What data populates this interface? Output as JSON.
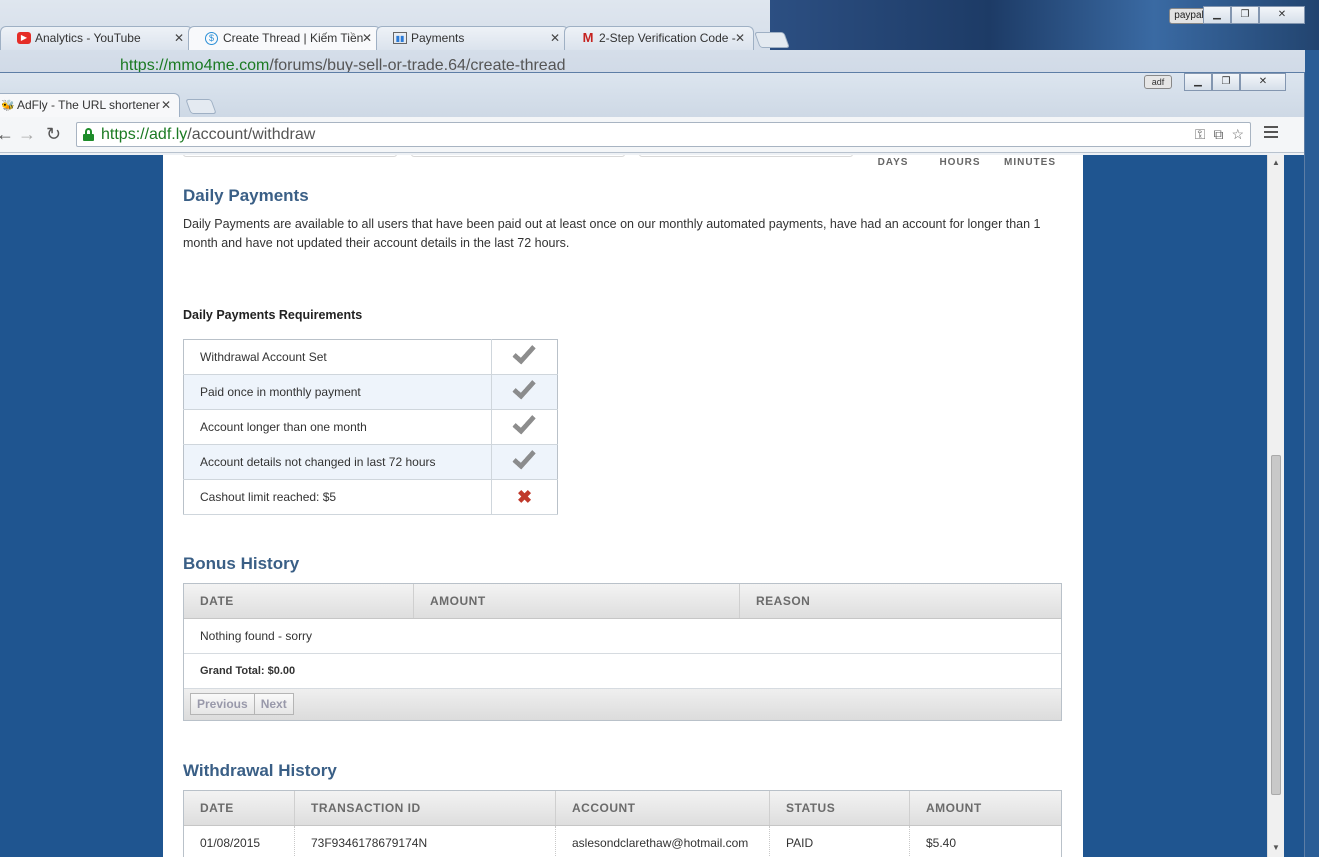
{
  "background_window": {
    "tabs": [
      {
        "label": "Analytics - YouTube",
        "icon": "youtube-icon"
      },
      {
        "label": "Create Thread | Kiếm Tiền",
        "icon": "site-icon"
      },
      {
        "label": "Payments",
        "icon": "analytics-icon"
      },
      {
        "label": "2-Step Verification Code -",
        "icon": "gmail-icon"
      }
    ],
    "profile_label": "paypal",
    "url_host": "https://mmo4me.com",
    "url_path": "/forums/buy-sell-or-trade.64/create-thread"
  },
  "window": {
    "tab_label": "AdFly - The URL shortener",
    "profile_label": "adf",
    "url_host": "https://adf.ly",
    "url_path": "/account/withdraw"
  },
  "countdown": {
    "days": "DAYS",
    "hours": "HOURS",
    "minutes": "MINUTES"
  },
  "daily_payments": {
    "title": "Daily Payments",
    "description": "Daily Payments are available to all users that have been paid out at least once on our monthly automated payments, have had an account for longer than 1 month and have not updated their account details in the last 72 hours.",
    "requirements_title": "Daily Payments Requirements",
    "requirements": [
      {
        "label": "Withdrawal Account Set",
        "status": "ok"
      },
      {
        "label": "Paid once in monthly payment",
        "status": "ok"
      },
      {
        "label": "Account longer than one month",
        "status": "ok"
      },
      {
        "label": "Account details not changed in last 72 hours",
        "status": "ok"
      },
      {
        "label": "Cashout limit reached: $5",
        "status": "fail"
      }
    ]
  },
  "bonus_history": {
    "title": "Bonus History",
    "columns": [
      "DATE",
      "AMOUNT",
      "REASON"
    ],
    "empty_text": "Nothing found - sorry",
    "grand_total": "Grand Total: $0.00",
    "prev_label": "Previous",
    "next_label": "Next"
  },
  "withdrawal_history": {
    "title": "Withdrawal History",
    "columns": [
      "DATE",
      "TRANSACTION ID",
      "ACCOUNT",
      "STATUS",
      "AMOUNT"
    ],
    "rows": [
      [
        "01/08/2015",
        "73F9346178679174N",
        "aslesondclarethaw@hotmail.com",
        "PAID",
        "$5.40"
      ]
    ]
  },
  "colors": {
    "heading": "#3a5f86",
    "page_bg": "#1f5590",
    "secure_green": "#1b7a23",
    "fail_red": "#c0392b"
  }
}
